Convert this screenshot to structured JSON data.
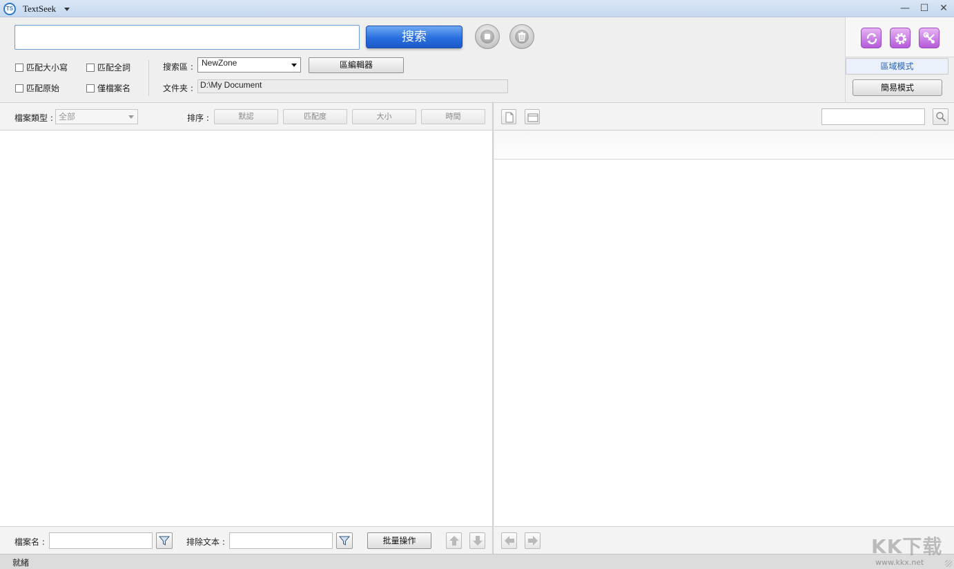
{
  "window": {
    "title": "TextSeek",
    "logo_text": "TS",
    "controls": {
      "minimize": "—",
      "maximize": "☐",
      "close": "✕"
    }
  },
  "toolbar": {
    "search": {
      "value": "",
      "placeholder": ""
    },
    "search_button": "搜索",
    "stop_icon": "stop-icon",
    "clear_icon": "trash-icon",
    "checkboxes": [
      {
        "label": "匹配大小寫",
        "checked": false
      },
      {
        "label": "匹配全詞",
        "checked": false
      },
      {
        "label": "匹配原始",
        "checked": false
      },
      {
        "label": "僅檔案名",
        "checked": false
      }
    ],
    "zone_label": "搜索區 :",
    "zone_value": "NewZone",
    "zone_editor_button": "區編輯器",
    "folder_label": "文件夹 :",
    "folder_value": "D:\\My Document"
  },
  "tool_panel": {
    "icons": [
      "refresh-icon",
      "settings-icon",
      "tools-icon"
    ],
    "mode_zone": "區域模式",
    "mode_simple": "簡易模式"
  },
  "results": {
    "file_type_label": "檔案類型 :",
    "file_type_value": "全部",
    "sort_label": "排序 :",
    "sort_buttons": [
      "默認",
      "匹配度",
      "大小",
      "時間"
    ]
  },
  "results_footer": {
    "filename_label": "檔案名 :",
    "filename_value": "",
    "exclude_label": "排除文本 :",
    "exclude_value": "",
    "batch_button": "批量操作"
  },
  "preview": {
    "find_value": ""
  },
  "status": {
    "text": "就緒"
  },
  "watermark": {
    "text": "KK下载",
    "url": "www.kkx.net"
  },
  "colors": {
    "titlebar": "#c7d9ef",
    "search_button": "#2a6fe0",
    "tool_icon": "#b45ad8",
    "active_mode_text": "#2a62b5"
  }
}
